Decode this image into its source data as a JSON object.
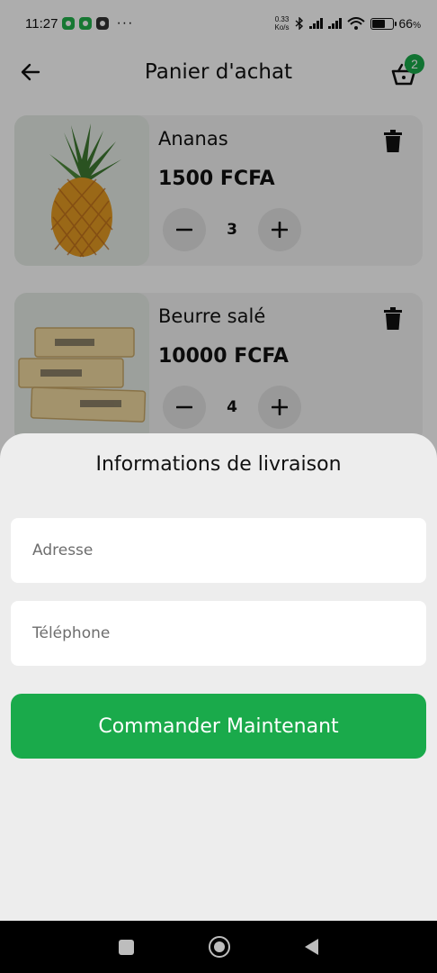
{
  "status_bar": {
    "time": "11:27",
    "dots": "···",
    "net_speed_value": "0.33",
    "net_speed_unit": "Ko/s",
    "battery_percent": "66",
    "battery_level": 0.66
  },
  "app_bar": {
    "title": "Panier d'achat",
    "basket_count": "2"
  },
  "cart_items": [
    {
      "name": "Ananas",
      "price": "1500 FCFA",
      "quantity": "3",
      "icon": "pineapple-image"
    },
    {
      "name": "Beurre salé",
      "price": "10000 FCFA",
      "quantity": "4",
      "icon": "butter-image"
    }
  ],
  "delivery_sheet": {
    "title": "Informations de livraison",
    "address_placeholder": "Adresse",
    "phone_placeholder": "Téléphone",
    "order_button": "Commander Maintenant"
  },
  "colors": {
    "accent": "#1aaa4b",
    "sheet_background": "#ededed"
  }
}
